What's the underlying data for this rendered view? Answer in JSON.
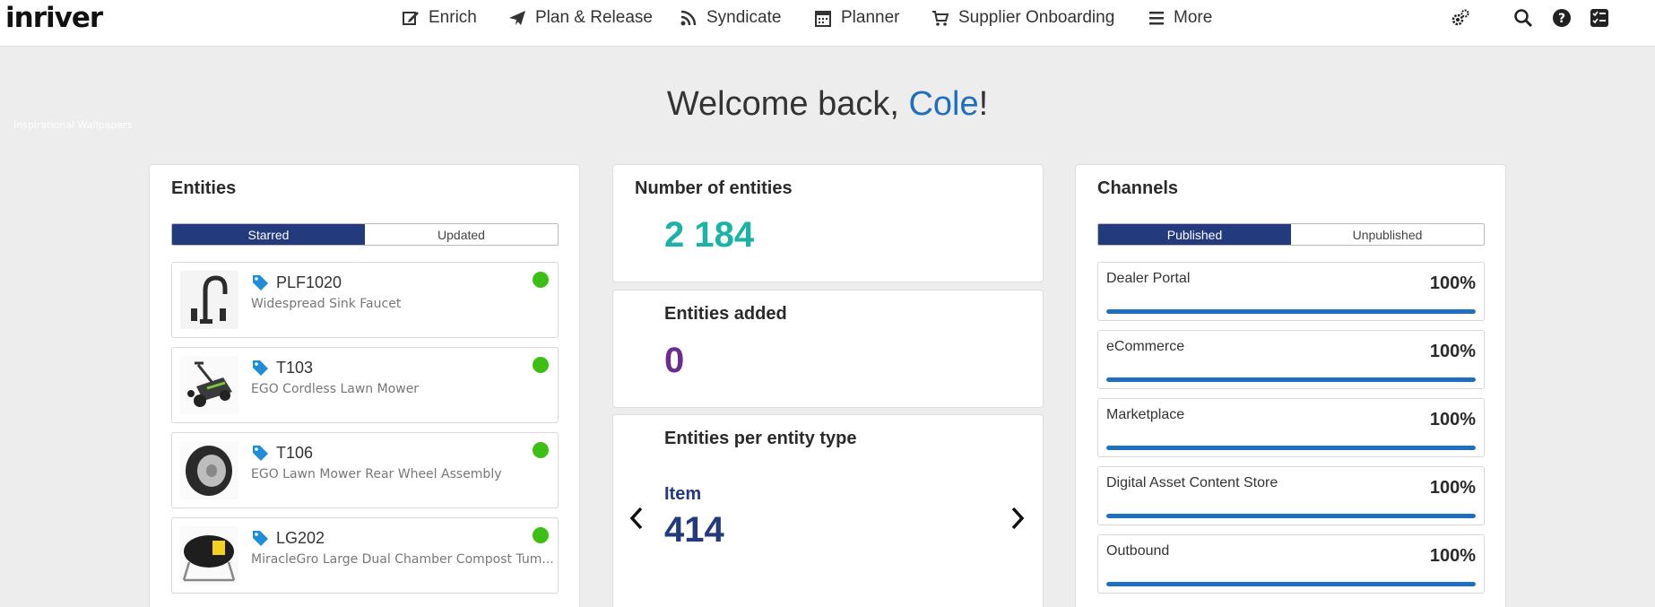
{
  "brand": {
    "logo": "inriver"
  },
  "nav": [
    {
      "label": "Enrich",
      "icon": "edit-icon"
    },
    {
      "label": "Plan & Release",
      "icon": "paper-plane-icon"
    },
    {
      "label": "Syndicate",
      "icon": "rss-icon"
    },
    {
      "label": "Planner",
      "icon": "calendar-icon"
    },
    {
      "label": "Supplier Onboarding",
      "icon": "cart-icon"
    },
    {
      "label": "More",
      "icon": "hamburger-icon"
    }
  ],
  "tools": [
    "settings-gears-icon",
    "search-icon",
    "help-icon",
    "tasks-icon"
  ],
  "wallpaper_credit": "Inspirational Wallpapers",
  "welcome": {
    "prefix": "Welcome back, ",
    "name": "Cole",
    "suffix": "!"
  },
  "entities": {
    "title": "Entities",
    "tabs": {
      "active": "Starred",
      "inactive": "Updated"
    },
    "items": [
      {
        "code": "PLF1020",
        "desc": "Widespread Sink Faucet",
        "thumb": "faucet-image"
      },
      {
        "code": "T103",
        "desc": "EGO Cordless Lawn Mower",
        "thumb": "lawn-mower-image"
      },
      {
        "code": "T106",
        "desc": "EGO Lawn Mower Rear Wheel Assembly",
        "thumb": "wheel-image"
      },
      {
        "code": "LG202",
        "desc": "MiracleGro Large Dual Chamber Compost Tum...",
        "thumb": "composter-image"
      }
    ]
  },
  "stats": {
    "number_title": "Number of entities",
    "number_value": "2 184",
    "added_title": "Entities added",
    "added_value": "0",
    "per_type_title": "Entities per entity type",
    "type_label": "Item",
    "type_value": "414"
  },
  "channels": {
    "title": "Channels",
    "tabs": {
      "active": "Published",
      "inactive": "Unpublished"
    },
    "items": [
      {
        "name": "Dealer Portal",
        "pct": "100%",
        "progress": 1.0
      },
      {
        "name": "eCommerce",
        "pct": "100%",
        "progress": 1.0
      },
      {
        "name": "Marketplace",
        "pct": "100%",
        "progress": 1.0
      },
      {
        "name": "Digital Asset Content Store",
        "pct": "100%",
        "progress": 1.0
      },
      {
        "name": "Outbound",
        "pct": "100%",
        "progress": 1.0
      }
    ]
  },
  "colors": {
    "accent_blue": "#1e6fbf",
    "toggle_active": "#233b7c",
    "number_teal": "#1ab3a6",
    "number_purple": "#6a2c8e",
    "number_navy": "#233b7c",
    "status_green": "#3dbf14"
  }
}
